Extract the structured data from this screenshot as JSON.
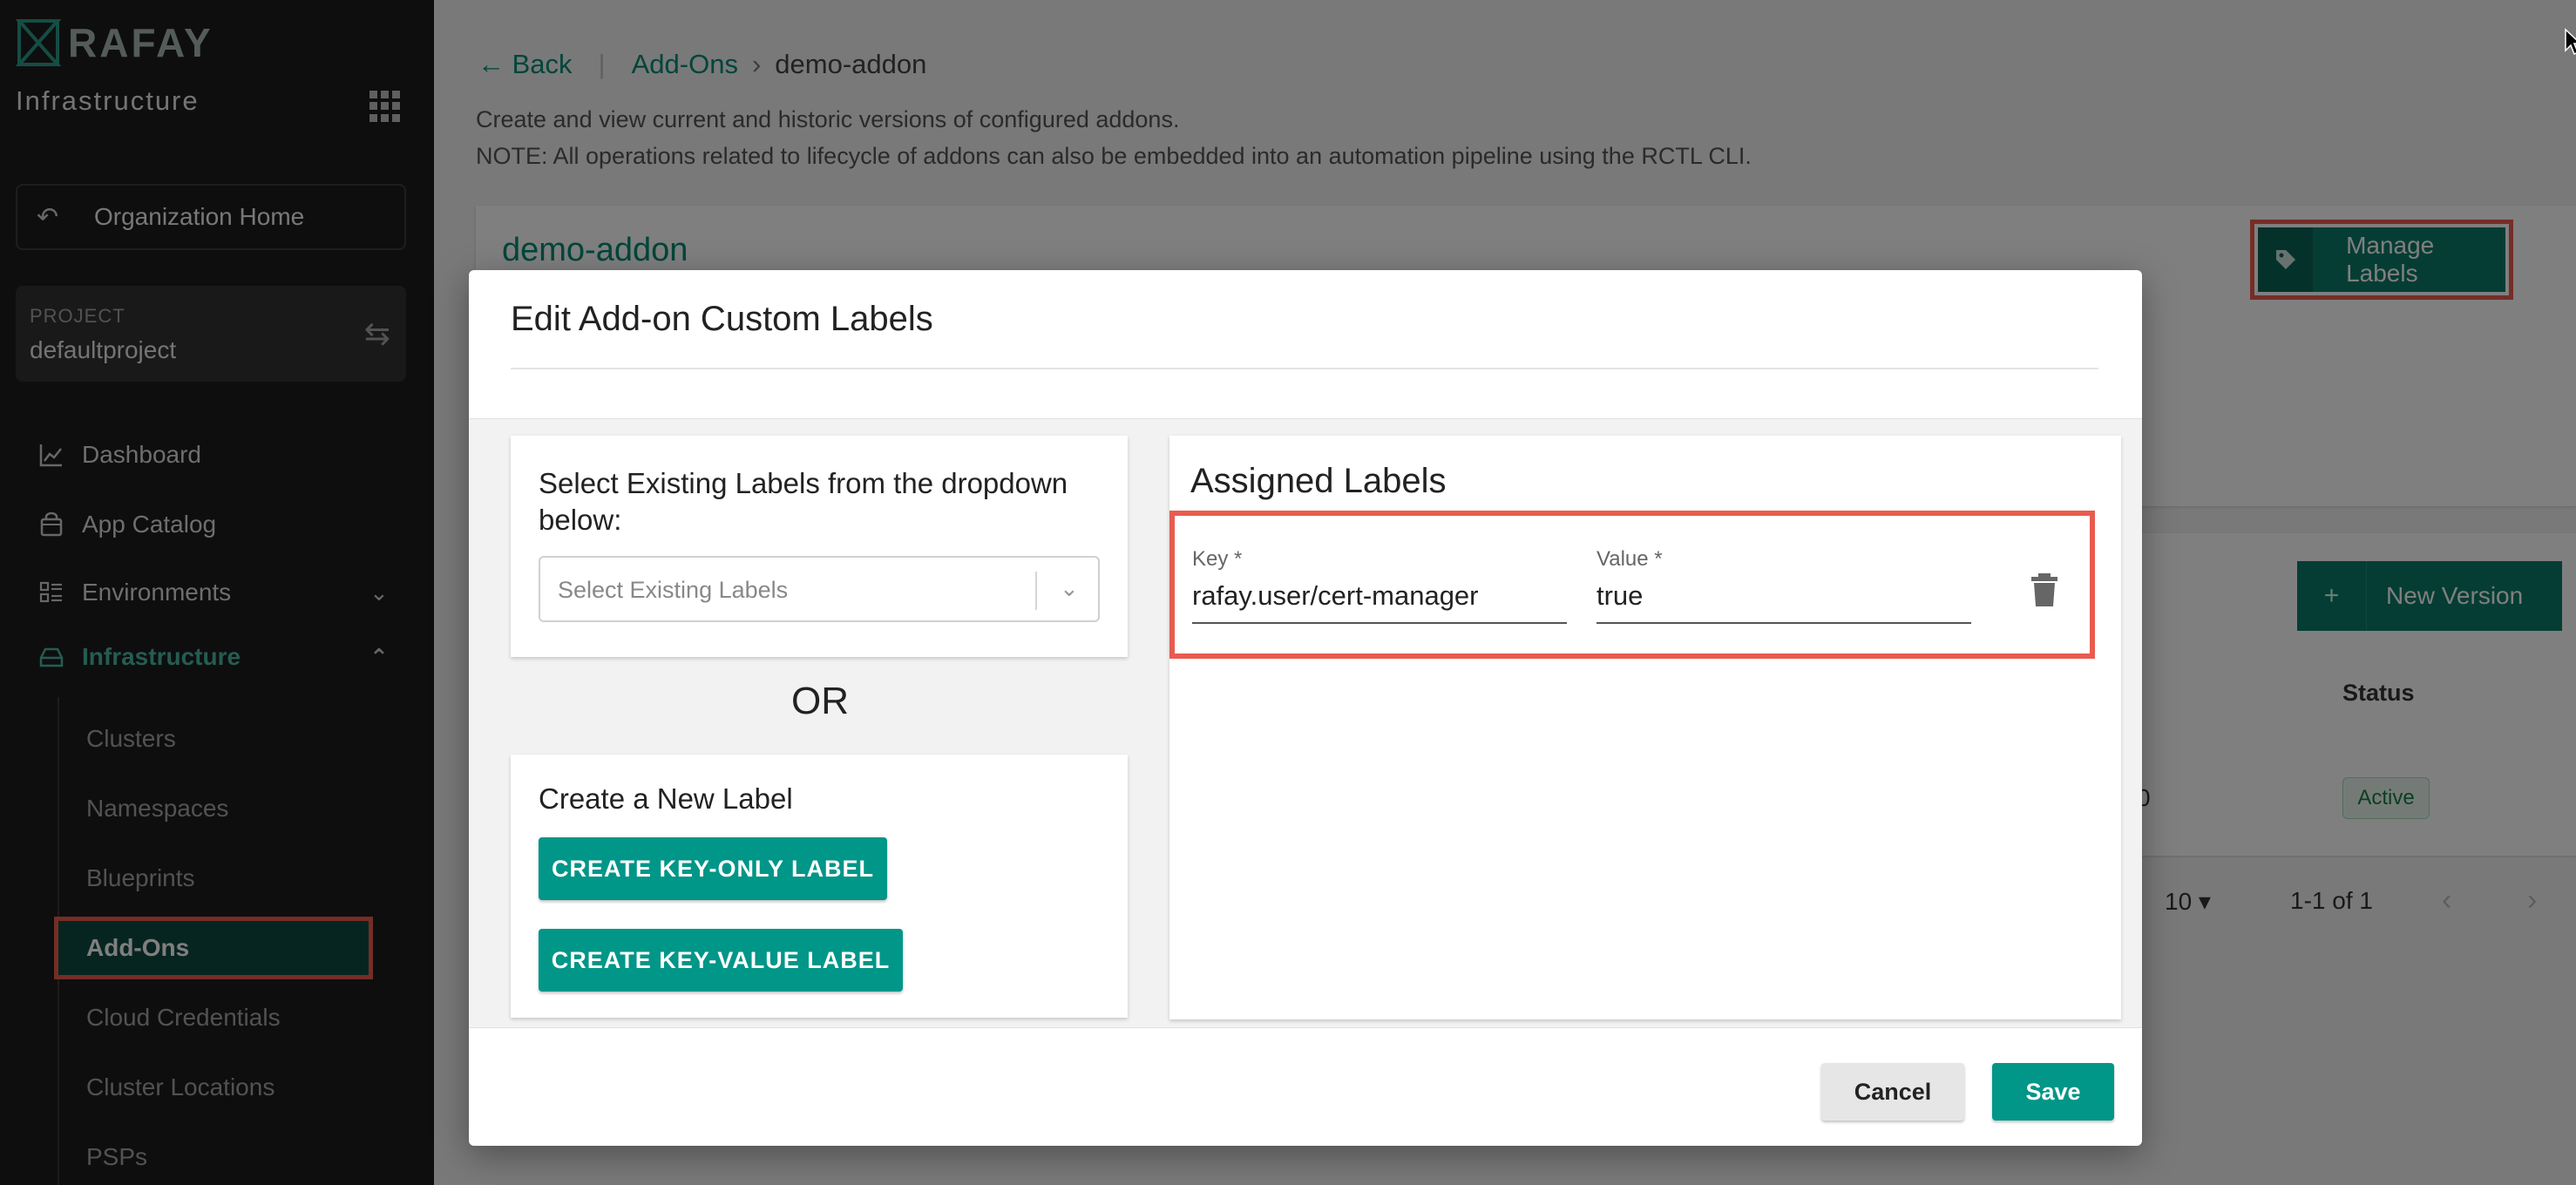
{
  "sidebar": {
    "logo_text": "RAFAY",
    "app_name": "Infrastructure",
    "org_home": "Organization Home",
    "project": {
      "label": "PROJECT",
      "name": "defaultproject"
    },
    "nav": {
      "dashboard": "Dashboard",
      "app_catalog": "App Catalog",
      "environments": "Environments",
      "infrastructure": "Infrastructure"
    },
    "sub_items": {
      "clusters": "Clusters",
      "namespaces": "Namespaces",
      "blueprints": "Blueprints",
      "addons": "Add-Ons",
      "cloud_credentials": "Cloud Credentials",
      "cluster_locations": "Cluster Locations",
      "psps": "PSPs"
    }
  },
  "header": {
    "back": "Back",
    "crumb_addons": "Add-Ons",
    "crumb_arrow": "›",
    "crumb_current": "demo-addon",
    "desc1": "Create and view current and historic versions of configured addons.",
    "desc2": "NOTE: All operations related to lifecycle of addons can also be embedded into an automation pipeline using the RCTL CLI."
  },
  "addon_card": {
    "title": "demo-addon",
    "manage_labels": "Manage Labels"
  },
  "versions": {
    "new_version": "New Version",
    "status_header": "Status",
    "row_fragment": "0",
    "status_badge": "Active",
    "page_size": "10",
    "page_range": "1-1 of 1"
  },
  "modal": {
    "title": "Edit Add-on Custom Labels",
    "select_section_title": "Select Existing Labels from the dropdown below:",
    "select_placeholder": "Select Existing Labels",
    "or_text": "OR",
    "create_section_title": "Create a New Label",
    "create_key_only": "CREATE KEY-ONLY LABEL",
    "create_key_value": "CREATE KEY-VALUE LABEL",
    "assigned_title": "Assigned Labels",
    "label": {
      "key_label": "Key *",
      "key_value": "rafay.user/cert-manager",
      "value_label": "Value *",
      "value_value": "true"
    },
    "cancel": "Cancel",
    "save": "Save"
  },
  "colors": {
    "brand_teal": "#009688",
    "highlight": "#ea5b4f",
    "sidebar_bg": "#1c1c1c"
  }
}
